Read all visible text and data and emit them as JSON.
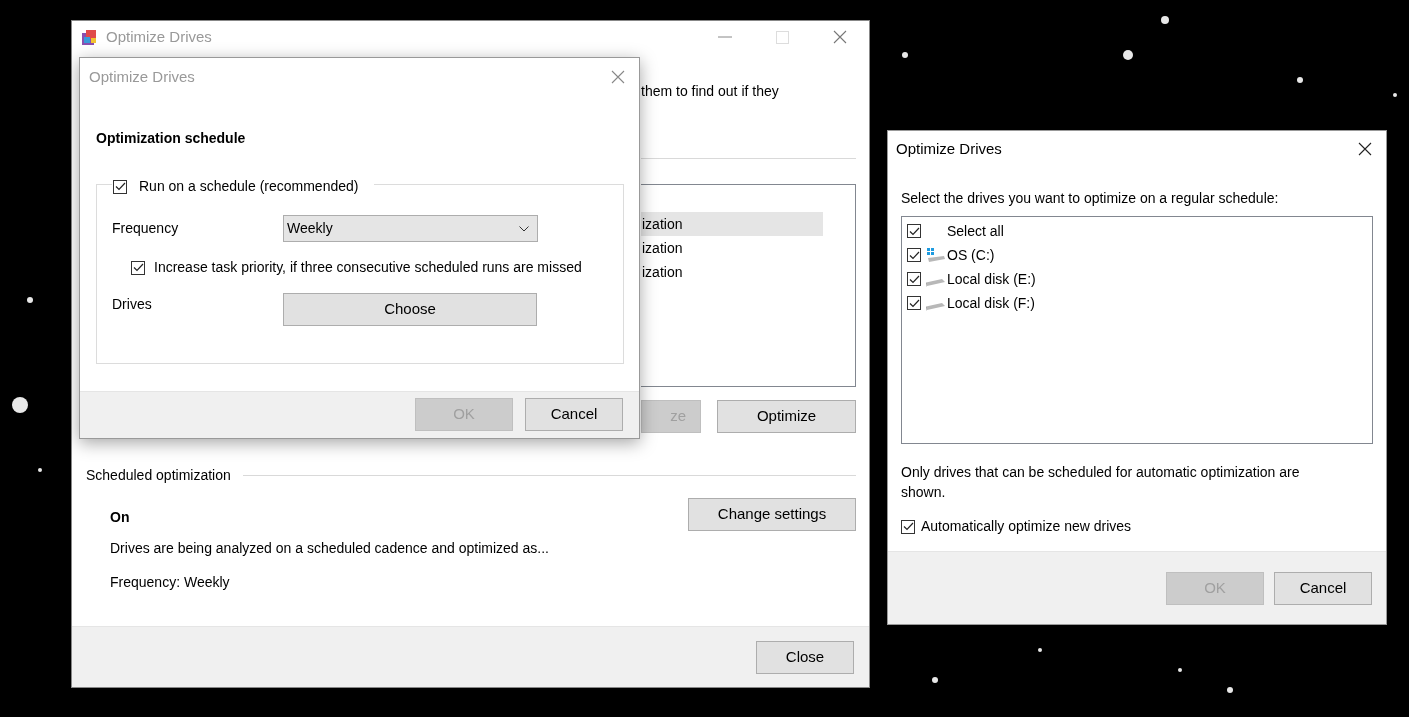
{
  "main_window": {
    "title": "Optimize Drives",
    "description_fragment": "them to find out if they",
    "drive_list": {
      "rows": [
        {
          "text": "ization",
          "selected": true
        },
        {
          "text": "ization",
          "selected": false
        },
        {
          "text": "ization",
          "selected": false
        }
      ]
    },
    "buttons": [
      {
        "label": "ze",
        "disabled": true
      },
      {
        "label": "Optimize",
        "disabled": false
      }
    ],
    "scheduled_optimization": {
      "heading": "Scheduled optimization",
      "status": "On",
      "description": "Drives are being analyzed on a scheduled cadence and optimized as...",
      "frequency": "Frequency: Weekly",
      "button": "Change settings"
    },
    "footer_button": "Close"
  },
  "schedule_dialog": {
    "window_title": "Optimize Drives",
    "heading": "Optimization schedule",
    "run_on_schedule": {
      "label": "Run on a schedule (recommended)",
      "checked": true
    },
    "frequency": {
      "label": "Frequency",
      "value": "Weekly"
    },
    "increase_priority": {
      "label": "Increase task priority, if three consecutive scheduled runs are missed",
      "checked": true
    },
    "drives": {
      "label": "Drives",
      "button": "Choose"
    },
    "buttons": [
      {
        "label": "OK",
        "disabled": true
      },
      {
        "label": "Cancel",
        "disabled": false
      }
    ]
  },
  "drives_dialog": {
    "window_title": "Optimize Drives",
    "prompt": "Select the drives you want to optimize on a regular schedule:",
    "items": [
      {
        "kind": "all",
        "label": "Select all",
        "checked": true
      },
      {
        "kind": "system",
        "label": "OS (C:)",
        "checked": true
      },
      {
        "kind": "disk",
        "label": "Local disk (E:)",
        "checked": true
      },
      {
        "kind": "disk",
        "label": "Local disk (F:)",
        "checked": true
      }
    ],
    "note": "Only drives that can be scheduled for automatic optimization are shown.",
    "auto_optimize": {
      "label": "Automatically optimize new drives",
      "checked": true
    },
    "buttons": [
      {
        "label": "OK",
        "disabled": true
      },
      {
        "label": "Cancel",
        "disabled": false
      }
    ]
  }
}
